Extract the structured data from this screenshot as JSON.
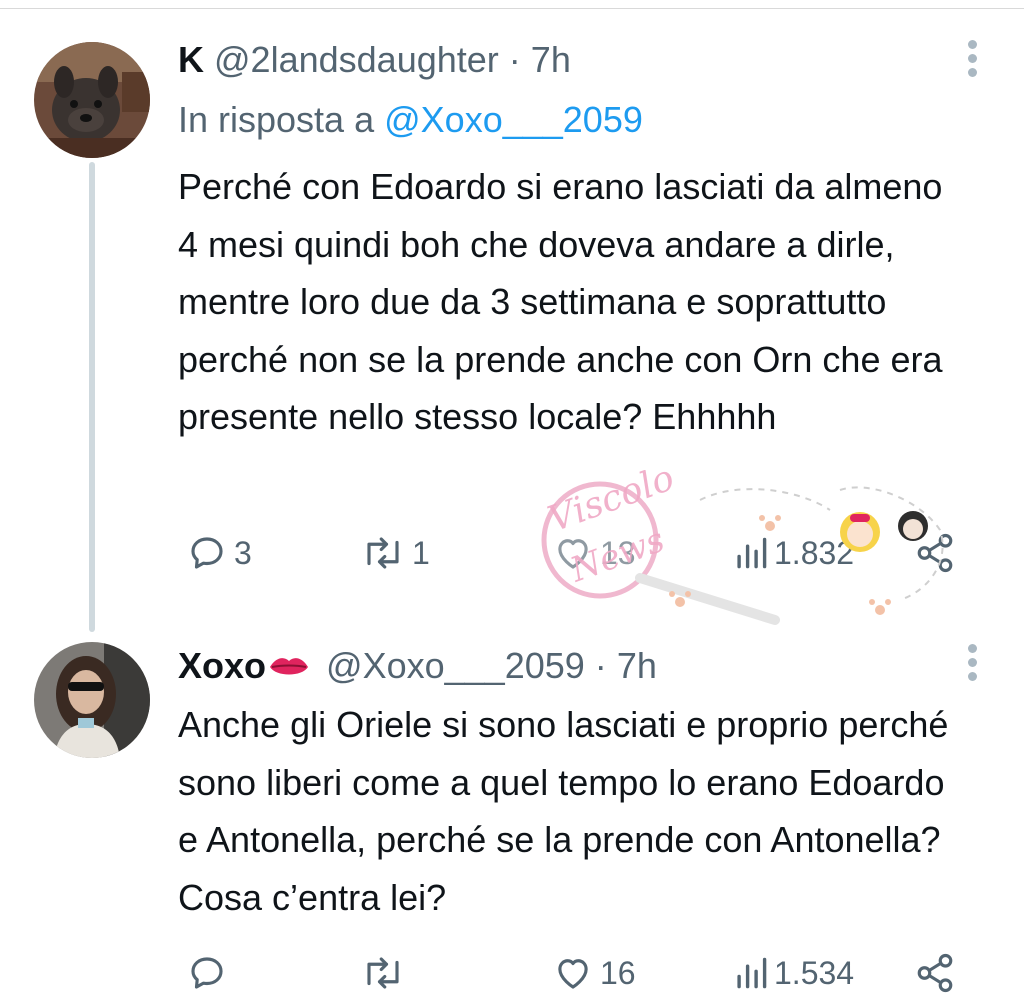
{
  "tweets": [
    {
      "name": "K",
      "handle": "@2landsdaughter",
      "separator": "·",
      "time": "7h",
      "reply_prefix": "In risposta a",
      "reply_to": "@Xoxo___2059",
      "text": "Perché con Edoardo si erano lasciati da almeno 4 mesi quindi boh che doveva andare a dirle, mentre loro due da 3 settimana e soprattutto perché non se la prende anche con Orn che era presente nello stesso locale? Ehhhhh",
      "replies": "3",
      "retweets": "1",
      "likes": "13",
      "views": "1.832"
    },
    {
      "name": "Xoxo",
      "handle": "@Xoxo___2059",
      "separator": "·",
      "time": "7h",
      "text": "Anche gli Oriele si sono lasciati e proprio perché sono liberi come a quel tempo lo erano Edoardo e Antonella, perché se la prende con Antonella? Cosa c’entra lei?",
      "replies": "",
      "retweets": "",
      "likes": "16",
      "views": "1.534"
    }
  ],
  "icons": {
    "reply": "comment-icon",
    "retweet": "retweet-icon",
    "like": "heart-icon",
    "views": "views-icon",
    "share": "share-icon",
    "more": "more-vertical-icon",
    "lips": "lips-emoji-icon"
  },
  "watermark": {
    "text_line1": "Viscolo",
    "text_line2": "News"
  },
  "colors": {
    "text": "#0f1419",
    "secondary": "#536471",
    "mention": "#1d9bf0",
    "thread_line": "#cfd9de"
  }
}
